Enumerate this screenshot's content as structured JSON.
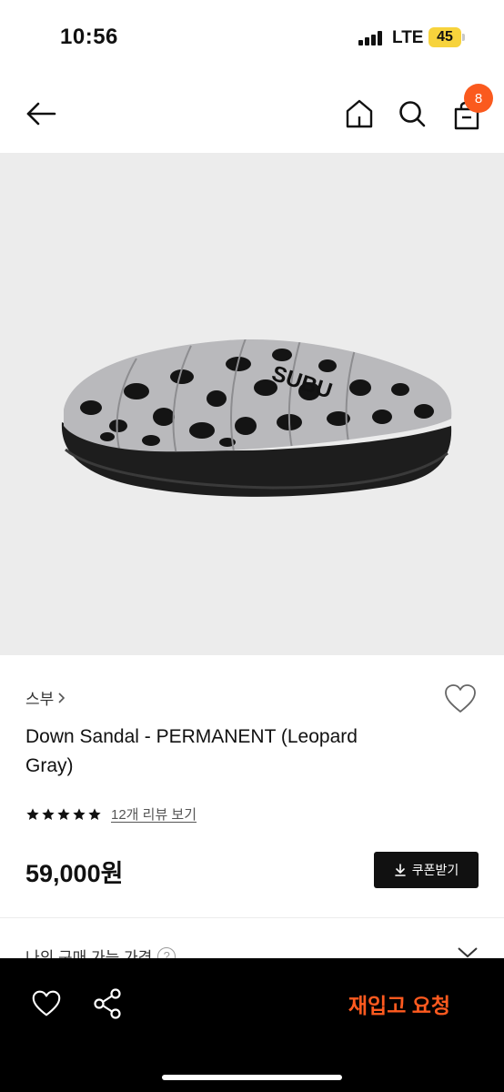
{
  "status_bar": {
    "time": "10:56",
    "network": "LTE",
    "battery": "45"
  },
  "header": {
    "back_icon": "arrow-left-icon",
    "home_icon": "home-icon",
    "search_icon": "search-icon",
    "cart_icon": "shopping-bag-icon",
    "cart_count": "8"
  },
  "product": {
    "brand": "스부",
    "name": "Down Sandal - PERMANENT (Leopard Gray)",
    "rating_stars": 5,
    "review_link": "12개 리뷰 보기",
    "price": "59,000원",
    "coupon_label": "쿠폰받기",
    "image_logo_text": "SUBU"
  },
  "partial_section": {
    "label": "나의 구매 가능 가격"
  },
  "bottom_bar": {
    "restock_label": "재입고 요청"
  },
  "colors": {
    "accent": "#fa5a1e",
    "image_bg": "#ececec",
    "bottom_bar_bg": "#000000"
  }
}
